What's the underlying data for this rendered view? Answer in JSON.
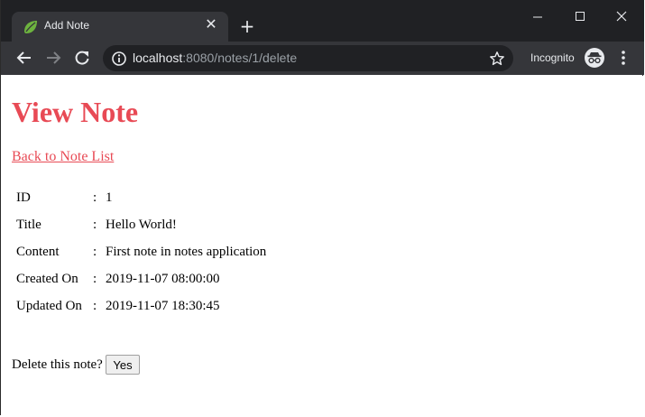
{
  "browser": {
    "tab_title": "Add Note",
    "url_host": "localhost",
    "url_rest": ":8080/notes/1/delete",
    "incognito_label": "Incognito"
  },
  "page": {
    "heading": "View Note",
    "back_link": "Back to Note List",
    "separator": ":",
    "fields": [
      {
        "label": "ID",
        "value": "1"
      },
      {
        "label": "Title",
        "value": "Hello World!"
      },
      {
        "label": "Content",
        "value": "First note in notes application"
      },
      {
        "label": "Created On",
        "value": "2019-11-07 08:00:00"
      },
      {
        "label": "Updated On",
        "value": "2019-11-07 18:30:45"
      }
    ],
    "delete_prompt": "Delete this note?",
    "yes_button": "Yes"
  },
  "colors": {
    "accent": "#e84a55",
    "chrome_dark": "#202124",
    "chrome_tab": "#35363a"
  },
  "icons": [
    "spring-leaf-icon",
    "close-icon",
    "plus-icon",
    "minimize-icon",
    "maximize-icon",
    "back-arrow-icon",
    "forward-arrow-icon",
    "reload-icon",
    "info-icon",
    "star-icon",
    "incognito-icon",
    "more-vert-icon"
  ]
}
